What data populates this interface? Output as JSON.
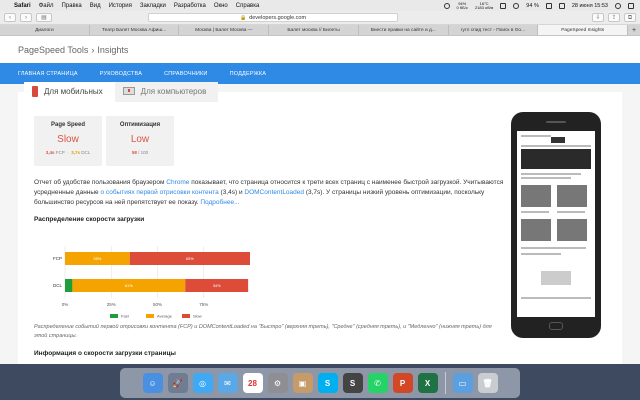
{
  "menubar": {
    "apple_icon": "",
    "app_name": "Safari",
    "items": [
      "Файл",
      "Правка",
      "Вид",
      "История",
      "Закладки",
      "Разработка",
      "Окно",
      "Справка"
    ],
    "battery": "94%",
    "battery_sub": "0 КБ/с",
    "temp": "16°C",
    "temp_sub": "2183 об/м",
    "wifi_pct": "94 %",
    "date_time": "28 июня  15:53"
  },
  "toolbar": {
    "url": "developers.google.com",
    "back": "‹",
    "forward": "›",
    "sidebar": "▤",
    "download": "⇩",
    "share": "⇪",
    "tabs_btn": "⧉"
  },
  "tabs": [
    {
      "label": "Диалоги",
      "active": false
    },
    {
      "label": "Театр Балет Москва Афиш...",
      "active": false
    },
    {
      "label": "Москва | Балет Москва —",
      "active": false
    },
    {
      "label": "Балет москва // Билеты",
      "active": false
    },
    {
      "label": "Внести правки на сайте и д...",
      "active": false
    },
    {
      "label": "гугл спид тест - Поиск в Go...",
      "active": false
    },
    {
      "label": "PageSpeed Insights",
      "active": true
    }
  ],
  "page": {
    "brand": "PageSpeed Tools",
    "separator": "›",
    "section": "Insights",
    "nav": [
      "ГЛАВНАЯ СТРАНИЦА",
      "РУКОВОДСТВА",
      "СПРАВОЧНИКИ",
      "ПОДДЕРЖКА"
    ],
    "tab_mobile": "Для мобильных",
    "tab_desktop": "Для компьютеров",
    "metrics": [
      {
        "title": "Page Speed",
        "value": "Slow",
        "sub_a": "3,4s",
        "sub_a_label": "FCP",
        "sub_b": "3,7s",
        "sub_b_label": "DCL"
      },
      {
        "title": "Оптимизация",
        "value": "Low",
        "sub_a": "58",
        "sub_a_label": "",
        "sub_b": "/ 100",
        "sub_b_label": ""
      }
    ],
    "description": {
      "p1": "Отчет об удобстве пользования браузером ",
      "link1": "Chrome",
      "p2": " показывает, что страница относится к трети всех страниц с наименее быстрой загрузкой. Учитываются усредненные данные ",
      "link2": "о событиях первой отрисовки контента",
      "p3": " (3,4s) и ",
      "link3": "DOMContentLoaded",
      "p4": " (3,7s). У страницы низкий уровень оптимизации, поскольку большинство ресурсов на ней препятствует ее показу. ",
      "link4": "Подробнее..."
    },
    "dist_heading": "Распределение скорости загрузки",
    "caption": "Распределение событий первой отрисовки контента (FCP) и DOMContentLoaded на \"Быстро\" (верхняя треть), \"Средне\" (средняя треть), и \"Медленно\" (нижняя треть) для этой страницы.",
    "info_heading": "Информация о скорости загрузки страницы"
  },
  "chart_data": {
    "type": "bar",
    "orientation": "horizontal",
    "stacked": true,
    "categories": [
      "FCP",
      "DCL"
    ],
    "series": [
      {
        "name": "Fast",
        "color": "#1e9e3c",
        "values": [
          0,
          4
        ]
      },
      {
        "name": "Average",
        "color": "#f5a300",
        "values": [
          35,
          61
        ]
      },
      {
        "name": "Slow",
        "color": "#dd4b39",
        "values": [
          65,
          34
        ]
      }
    ],
    "data_labels": [
      [
        "",
        "35%",
        "65%"
      ],
      [
        "",
        "61%",
        "34%"
      ]
    ],
    "xticks": [
      "0%",
      "25%",
      "50%",
      "75%"
    ],
    "xlim": [
      0,
      100
    ],
    "legend_position": "bottom"
  },
  "dock": {
    "apps": [
      {
        "name": "finder-icon",
        "color": "#4a90e2",
        "glyph": "☺"
      },
      {
        "name": "launchpad-icon",
        "color": "#6f7c91",
        "glyph": "🚀"
      },
      {
        "name": "safari-icon",
        "color": "#3fa9f5",
        "glyph": "◎"
      },
      {
        "name": "mail-icon",
        "color": "#5aa9e6",
        "glyph": "✉"
      },
      {
        "name": "calendar-icon",
        "color": "#ffffff",
        "glyph": "28"
      },
      {
        "name": "preferences-icon",
        "color": "#8e8e93",
        "glyph": "⚙"
      },
      {
        "name": "photos-app-icon",
        "color": "#c79a6a",
        "glyph": "▣"
      },
      {
        "name": "skype-icon",
        "color": "#00aff0",
        "glyph": "S"
      },
      {
        "name": "stickies-icon",
        "color": "#444444",
        "glyph": "S"
      },
      {
        "name": "whatsapp-icon",
        "color": "#25d366",
        "glyph": "✆"
      },
      {
        "name": "powerpoint-icon",
        "color": "#d24726",
        "glyph": "P"
      },
      {
        "name": "excel-icon",
        "color": "#1f7244",
        "glyph": "X"
      },
      {
        "name": "downloads-folder-icon",
        "color": "#5aa0e0",
        "glyph": "▭"
      },
      {
        "name": "trash-icon",
        "color": "#c9ccd1",
        "glyph": "🗑"
      }
    ]
  }
}
